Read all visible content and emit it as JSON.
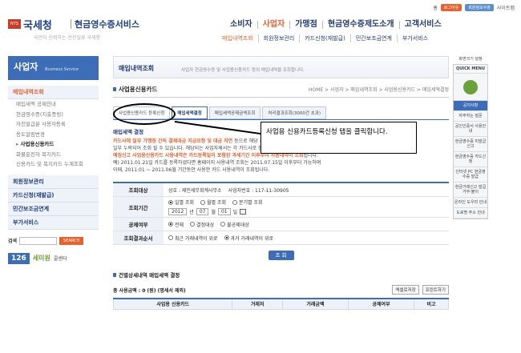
{
  "header": {
    "logo_badge": "NTS",
    "logo_name": "국세청",
    "service_name": "현금영수증서비스",
    "slogan": "국민이 신뢰하는 선진일류 국세청",
    "util": {
      "home": "홈",
      "login": "로그아웃",
      "join": "회원정보수정",
      "sitemap": "사이트맵"
    },
    "gnb": [
      "소비자",
      "사업자",
      "가맹점",
      "현금영수증제도소개",
      "고객서비스"
    ],
    "sub": [
      "매입내역조회",
      "회원정보관리",
      "카드신청(재발급)",
      "민간보조금연계",
      "부가서비스"
    ]
  },
  "sidebar": {
    "title": "사업자",
    "subtitle": "Business Service",
    "main_item": "매입내역조회",
    "sub_items": [
      "매입세액 공제안내",
      "현금영수증(지출증빙)",
      "자진발급분 사용자등록",
      "용도알림변경",
      "사업용신용카드",
      "화물운전자 복지카드",
      "신용카드 및 복지카드 누계조회"
    ],
    "sub_active_index": 4,
    "groups": [
      "회원정보관리",
      "카드신청(재발급)",
      "민간보조금연계",
      "부가서비스"
    ],
    "search_label": "검색",
    "search_button": "SEARCH",
    "banner_num": "126",
    "banner_txt": "세미원",
    "banner_txt2": "콜센터"
  },
  "content": {
    "page_title": "매입내역조회",
    "page_desc": "사업자 현금영수증 및 사업용신용카드 등의 매입내역을 조회합니다.",
    "section_title": "사업용신용카드",
    "breadcrumb": "HOME > 사업자 > 매입내역조회 > 사업용신용카드 > 매입세액결정",
    "tabs": [
      "사업용신용카드 등록신청",
      "매입세액결정",
      "매입세액공제금액조회",
      "처리결과조회(3000건 초과)"
    ],
    "caution_title": "매입세액 결정",
    "caution_1a": "카드사에 일부 가맹점 간의 결제대금 지급요청 및 대금 지연",
    "caution_1b": "등으로 해당 과세기간의 사업용신용카드 사용내역이",
    "caution_1c": "일부 누락되어 조회 될 수 있습니다. 해당되는 사업자께서는 각 카드사로 문의하시기 바랍니다.",
    "caution_2a": "예정신고 사업용신용카드 사용내역은 카드등록일이 포함된 과세기간 이후부터 사용내역이 조회",
    "caution_2b": "됩니다.",
    "caution_3": "예) 2011.01.21일 카드를 등록하셨다면 홈페이지 사용내역 조회는 2011.07.15일 이후부터 가능하며",
    "caution_4": "이때, 2011.01 ~ 2011.06월 기간동안 사용한 카드 사용내역이 조회됩니다.",
    "form": {
      "target_label": "조회대상",
      "target_value": "상호 : 제인세무회계사무소",
      "biz_no_label": "사업자번호 : 117-11-30905",
      "period_label": "조회기간",
      "period_options": [
        "일별 조회",
        "월별 조회",
        "분기별 조회"
      ],
      "year": "2012",
      "year_unit": "년",
      "month": "07",
      "month_unit": "월",
      "day": "01",
      "day_unit": "일",
      "deduct_label": "공제여부",
      "deduct_options": [
        "전체",
        "결정대상",
        "불공제대상"
      ],
      "sort_label": "조회결과순서",
      "sort_options": [
        "최근 거래내역이 위로",
        "과거 거래내역이 위로"
      ],
      "query_button": "조 회"
    },
    "section2": "건별상세내역 매입세액 결정",
    "total": "총 사용금액 : 0 (원) (명세서 제외)",
    "btn_excel": "엑셀로저장",
    "btn_print": "프린트하기",
    "table_headers": [
      "사업용 신용카드",
      "거래처",
      "거래금액",
      "공제여부",
      "비고"
    ]
  },
  "quick": {
    "top_label": "화면크기 설정",
    "menu_label": "QUICK MENU",
    "items": [
      "자주하는 질문",
      "공인인증서 사용안내",
      "현금영수증 미발급신고",
      "현금영수증 카드신청",
      "인터넷 PC 현금영수증 발급",
      "현금거래신고 발급거부·불이",
      "온라인 도우미 안내",
      "도로명 주소 안내"
    ],
    "highlight": "공지사항",
    "highlight2": "자주하는 질문"
  },
  "annotation": {
    "callout_text": "사업용 신용카드등록신청 탭을 클릭합니다."
  }
}
